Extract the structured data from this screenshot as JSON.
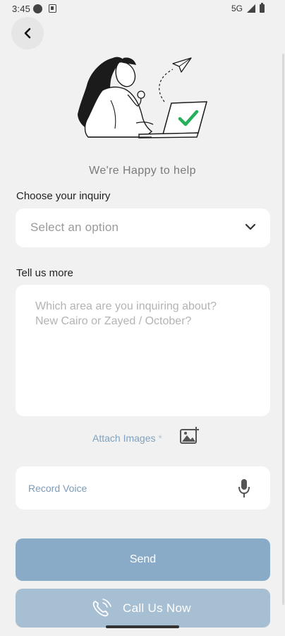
{
  "status_bar": {
    "time": "3:45",
    "network": "5G"
  },
  "header": {
    "tagline": "We're Happy to help"
  },
  "inquiry": {
    "label": "Choose your inquiry",
    "placeholder": "Select an option"
  },
  "details": {
    "label": "Tell us more",
    "placeholder": "Which area are you inquiring about?\nNew Cairo or Zayed / October?"
  },
  "attach": {
    "label": "Attach Images",
    "required_mark": "*"
  },
  "voice": {
    "label": "Record Voice"
  },
  "actions": {
    "send_label": "Send",
    "call_label": "Call Us Now"
  },
  "colors": {
    "background": "#f1f1f1",
    "primary": "#8aabc7",
    "secondary": "#a7bfd3",
    "accent_check": "#22b05a",
    "link": "#7fa1bf"
  },
  "icons": {
    "back": "chevron-left-icon",
    "dropdown": "chevron-down-icon",
    "image": "image-add-icon",
    "mic": "microphone-icon",
    "phone": "phone-call-icon"
  }
}
